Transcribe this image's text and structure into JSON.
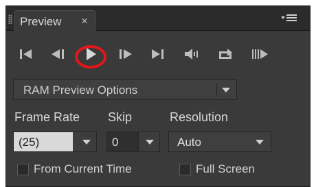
{
  "panel": {
    "tab_label": "Preview",
    "tab_close": "×",
    "menu_icon": "panel-menu-icon"
  },
  "controls": [
    {
      "name": "first-frame",
      "icon": "first-frame-icon"
    },
    {
      "name": "previous-frame",
      "icon": "previous-frame-icon"
    },
    {
      "name": "play-pause",
      "icon": "play-icon"
    },
    {
      "name": "next-frame",
      "icon": "next-frame-icon"
    },
    {
      "name": "last-frame",
      "icon": "last-frame-icon"
    },
    {
      "name": "mute-audio",
      "icon": "speaker-icon"
    },
    {
      "name": "loop",
      "icon": "loop-icon"
    },
    {
      "name": "ram-preview",
      "icon": "ram-preview-icon"
    }
  ],
  "preview_options": {
    "selected": "RAM Preview Options"
  },
  "settings": {
    "frame_rate_label": "Frame Rate",
    "frame_rate_value": "(25)",
    "skip_label": "Skip",
    "skip_value": "0",
    "resolution_label": "Resolution",
    "resolution_value": "Auto"
  },
  "checkboxes": {
    "from_current_time": {
      "label": "From Current Time",
      "checked": false
    },
    "full_screen": {
      "label": "Full Screen",
      "checked": false
    }
  },
  "colors": {
    "panel_bg": "#3a3a3a",
    "highlight": "#e3161c",
    "text": "#d6d6d6"
  }
}
